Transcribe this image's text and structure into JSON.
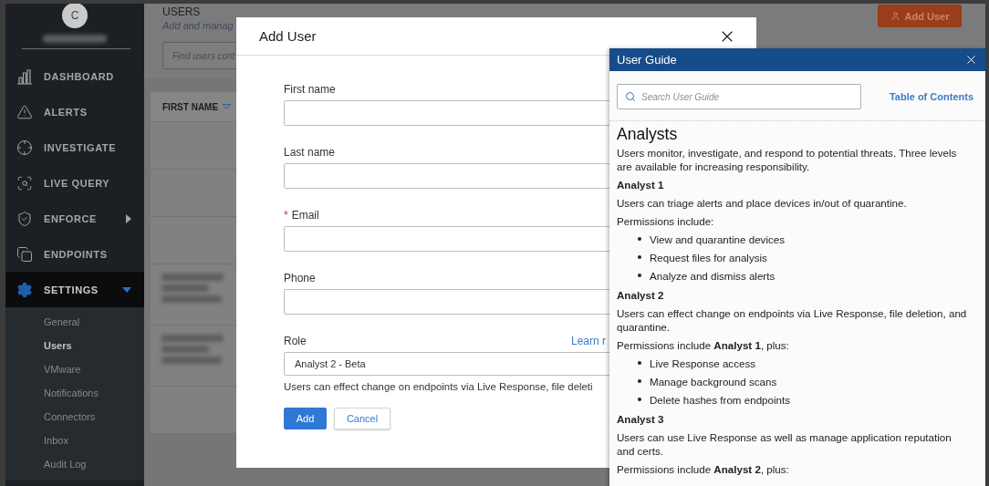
{
  "sidebar": {
    "avatar": "C",
    "account_redacted": true,
    "nav": [
      {
        "label": "DASHBOARD",
        "selected": false
      },
      {
        "label": "ALERTS",
        "selected": false
      },
      {
        "label": "INVESTIGATE",
        "selected": false
      },
      {
        "label": "LIVE QUERY",
        "selected": false
      },
      {
        "label": "ENFORCE",
        "selected": false,
        "expanded": false
      },
      {
        "label": "ENDPOINTS",
        "selected": false
      },
      {
        "label": "SETTINGS",
        "selected": true,
        "expanded": true,
        "children": [
          {
            "label": "General",
            "selected": false
          },
          {
            "label": "Users",
            "selected": true
          },
          {
            "label": "VMware",
            "selected": false
          },
          {
            "label": "Notifications",
            "selected": false
          },
          {
            "label": "Connectors",
            "selected": false
          },
          {
            "label": "Inbox",
            "selected": false
          },
          {
            "label": "Audit Log",
            "selected": false
          }
        ]
      }
    ]
  },
  "page": {
    "title": "USERS",
    "subtitle": "Add and manag",
    "search_placeholder": "Find users cont",
    "add_button": "Add User"
  },
  "table": {
    "columns": [
      {
        "label": "FIRST NAME",
        "sorted": true
      }
    ],
    "rows": [
      {
        "redacted": false
      },
      {
        "redacted": false
      },
      {
        "redacted": false
      },
      {
        "redacted": true
      },
      {
        "redacted": true
      },
      {
        "redacted": false
      }
    ]
  },
  "modal": {
    "title": "Add User",
    "fields": [
      {
        "kind": "text",
        "label": "First name",
        "required": false
      },
      {
        "kind": "text",
        "label": "Last name",
        "required": false
      },
      {
        "kind": "text",
        "label": "Email",
        "required": true,
        "marker": "*"
      },
      {
        "kind": "text",
        "label": "Phone",
        "required": false
      },
      {
        "kind": "select",
        "label": "Role",
        "required": false,
        "value": "Analyst 2 - Beta",
        "link": "Learn r",
        "help": "Users can effect change on endpoints via Live Response, file deleti"
      }
    ],
    "buttons": [
      {
        "label": "Add",
        "primary": true
      },
      {
        "label": "Cancel",
        "primary": false
      }
    ]
  },
  "guide": {
    "title": "User Guide",
    "search_placeholder": "Search User Guide",
    "toc_link": "Table of Contents",
    "heading": "Analysts",
    "blocks": [
      {
        "kind": "paragraph",
        "text": "Users monitor, investigate, and respond to potential threats. Three levels are available for increasing responsibility."
      },
      {
        "kind": "subheading",
        "text": "Analyst 1"
      },
      {
        "kind": "paragraph",
        "text": "Users can triage alerts and place devices in/out of quarantine."
      },
      {
        "kind": "paragraph",
        "text": "Permissions include:"
      },
      {
        "kind": "list",
        "items": [
          "View and quarantine devices",
          "Request files for analysis",
          "Analyze and dismiss alerts"
        ]
      },
      {
        "kind": "subheading",
        "text": "Analyst 2"
      },
      {
        "kind": "paragraph",
        "text": "Users can effect change on endpoints via Live Response, file deletion, and quarantine."
      },
      {
        "kind": "paragraph",
        "text": "Permissions include **Analyst 1**, plus:"
      },
      {
        "kind": "list",
        "items": [
          "Live Response access",
          "Manage background scans",
          "Delete hashes from endpoints"
        ]
      },
      {
        "kind": "subheading",
        "text": "Analyst 3"
      },
      {
        "kind": "paragraph",
        "text": "Users can use Live Response as well as manage application reputation and certs."
      },
      {
        "kind": "paragraph",
        "text": "Permissions include **Analyst 2**, plus:"
      }
    ]
  }
}
